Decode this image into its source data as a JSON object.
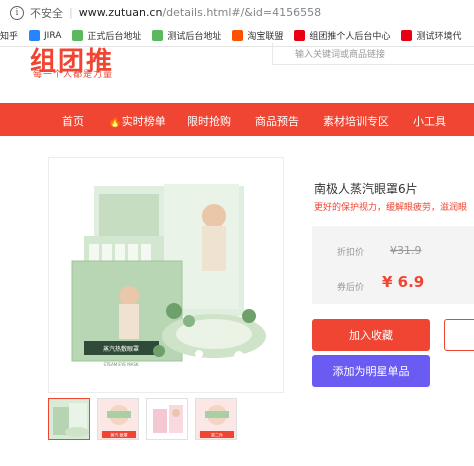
{
  "address_bar": {
    "security_label": "不安全",
    "host": "www.zutuan.cn",
    "path": "/details.html#/&id=4156558"
  },
  "bookmarks": [
    {
      "label": "知乎",
      "color": "#e8e8e8"
    },
    {
      "label": "JIRA",
      "color": "#2684ff"
    },
    {
      "label": "正式后台地址",
      "color": "#5cb85c"
    },
    {
      "label": "测试后台地址",
      "color": "#5cb85c"
    },
    {
      "label": "淘宝联盟",
      "color": "#ff5000"
    },
    {
      "label": "组团推个人后台中心",
      "color": "#e60012"
    },
    {
      "label": "测试环境代",
      "color": "#e60012"
    }
  ],
  "header": {
    "logo_text": "组团推",
    "slogan": "每一个人都是力量",
    "search_placeholder": "输入关键词或商品链接"
  },
  "nav": {
    "items": [
      "首页",
      "🔥实时榜单",
      "限时抢购",
      "商品预告",
      "素材培训专区",
      "小工具"
    ]
  },
  "product": {
    "title": "南极人蒸汽眼罩6片",
    "subtitle": "更好的保护视力，缓解眼疲劳，滋润眼",
    "original_price_label": "折扣价",
    "original_price": "¥31.9",
    "coupon_price_label": "券后价",
    "coupon_price": "¥ 6.9",
    "package_label": "蒸汽热敷眼罩",
    "package_sub": "STEAM EYE MASK",
    "thumb_tags": [
      "",
      "蒸汽 眼罩",
      "",
      "第二件"
    ]
  },
  "buttons": {
    "add_favorite": "加入收藏",
    "add_star": "添加为明星单品"
  },
  "colors": {
    "brand_red": "#ef4532",
    "purple": "#6a5cf2"
  }
}
